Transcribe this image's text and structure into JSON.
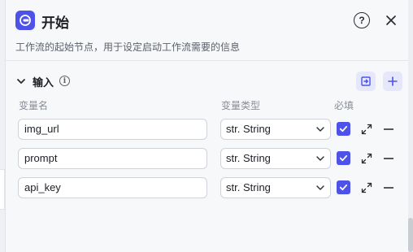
{
  "header": {
    "title": "开始",
    "description": "工作流的起始节点，用于设定启动工作流需要的信息",
    "help_symbol": "?"
  },
  "section": {
    "title": "输入",
    "info_symbol": "i"
  },
  "columns": {
    "name": "变量名",
    "type": "变量类型",
    "required": "必填"
  },
  "rows": [
    {
      "name": "img_url",
      "type": "str. String",
      "required": true
    },
    {
      "name": "prompt",
      "type": "str. String",
      "required": true
    },
    {
      "name": "api_key",
      "type": "str. String",
      "required": true
    }
  ],
  "colors": {
    "accent": "#4d53e8",
    "accent_light": "#e6e7fb"
  }
}
